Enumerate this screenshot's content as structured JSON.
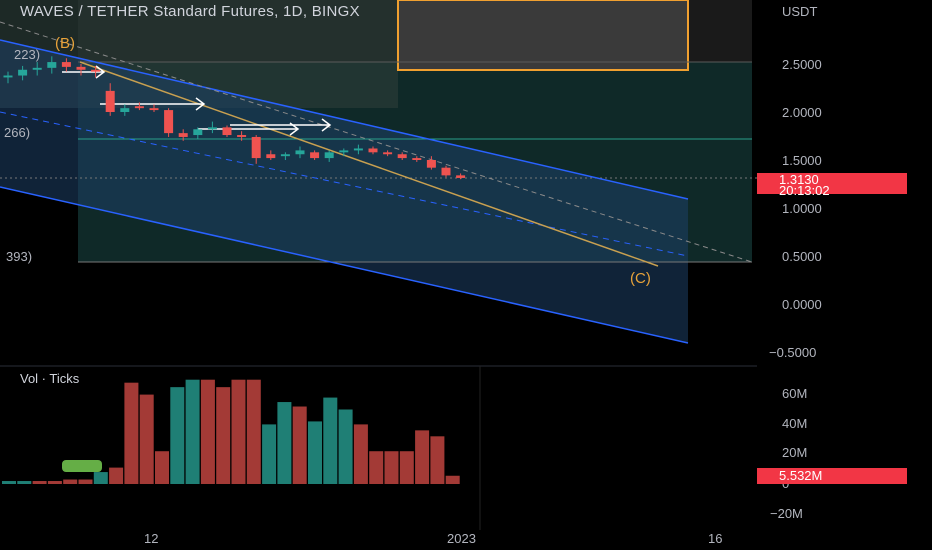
{
  "header": {
    "title": "WAVES / TETHER Standard Futures, 1D, BINGX",
    "currency": "USDT"
  },
  "price_axis": {
    "ticks": [
      "2.5000",
      "2.0000",
      "1.5000",
      "1.0000",
      "0.5000",
      "0.0000",
      "−0.5000"
    ],
    "last_price": "1.3130",
    "countdown": "20:13:02",
    "last_price_color": "#f23645"
  },
  "volume_pane": {
    "legend": "Vol · Ticks",
    "ticks": [
      "60M",
      "40M",
      "20M",
      "0",
      "−20M"
    ],
    "last_volume": "5.532M"
  },
  "time_axis": {
    "labels": [
      "12",
      "2023",
      "16"
    ]
  },
  "annotations": {
    "wave_b": "(B)",
    "wave_c": "(C)",
    "fib_1": "223)",
    "fib_2": "266)",
    "fib_3": "393)"
  },
  "colors": {
    "up": "#26a69a",
    "down": "#ef5350",
    "channel": "#2962ff",
    "zone": "#1e4d6b",
    "accent": "#f0a030"
  },
  "chart_data": {
    "type": "candlestick",
    "price_unit": "USDT",
    "series": [
      {
        "name": "price",
        "ohlc": [
          [
            2.36,
            2.42,
            2.3,
            2.38
          ],
          [
            2.38,
            2.48,
            2.33,
            2.44
          ],
          [
            2.44,
            2.52,
            2.38,
            2.46
          ],
          [
            2.46,
            2.58,
            2.4,
            2.52
          ],
          [
            2.52,
            2.56,
            2.42,
            2.47
          ],
          [
            2.47,
            2.5,
            2.38,
            2.44
          ],
          [
            2.44,
            2.48,
            2.36,
            2.42
          ],
          [
            2.22,
            2.3,
            1.96,
            2.0
          ],
          [
            2.0,
            2.08,
            1.96,
            2.04
          ],
          [
            2.06,
            2.1,
            2.02,
            2.04
          ],
          [
            2.04,
            2.08,
            2.0,
            2.02
          ],
          [
            2.02,
            2.04,
            1.74,
            1.78
          ],
          [
            1.78,
            1.82,
            1.7,
            1.74
          ],
          [
            1.76,
            1.84,
            1.72,
            1.82
          ],
          [
            1.82,
            1.9,
            1.78,
            1.84
          ],
          [
            1.84,
            1.86,
            1.74,
            1.76
          ],
          [
            1.76,
            1.8,
            1.7,
            1.74
          ],
          [
            1.74,
            1.76,
            1.46,
            1.52
          ],
          [
            1.56,
            1.6,
            1.5,
            1.52
          ],
          [
            1.54,
            1.58,
            1.5,
            1.56
          ],
          [
            1.56,
            1.64,
            1.52,
            1.6
          ],
          [
            1.58,
            1.6,
            1.5,
            1.52
          ],
          [
            1.52,
            1.6,
            1.48,
            1.58
          ],
          [
            1.58,
            1.62,
            1.54,
            1.6
          ],
          [
            1.6,
            1.66,
            1.56,
            1.62
          ],
          [
            1.62,
            1.64,
            1.56,
            1.58
          ],
          [
            1.58,
            1.6,
            1.54,
            1.56
          ],
          [
            1.56,
            1.58,
            1.5,
            1.52
          ],
          [
            1.52,
            1.54,
            1.48,
            1.5
          ],
          [
            1.5,
            1.54,
            1.4,
            1.42
          ],
          [
            1.42,
            1.44,
            1.32,
            1.34
          ],
          [
            1.34,
            1.36,
            1.3,
            1.313
          ]
        ]
      },
      {
        "name": "volume",
        "unit": "M",
        "values": [
          2,
          2,
          2,
          2,
          3,
          3,
          8,
          11,
          68,
          60,
          22,
          65,
          70,
          70,
          65,
          70,
          70,
          40,
          55,
          52,
          42,
          58,
          50,
          40,
          22,
          22,
          22,
          36,
          32,
          5.532
        ]
      }
    ]
  }
}
